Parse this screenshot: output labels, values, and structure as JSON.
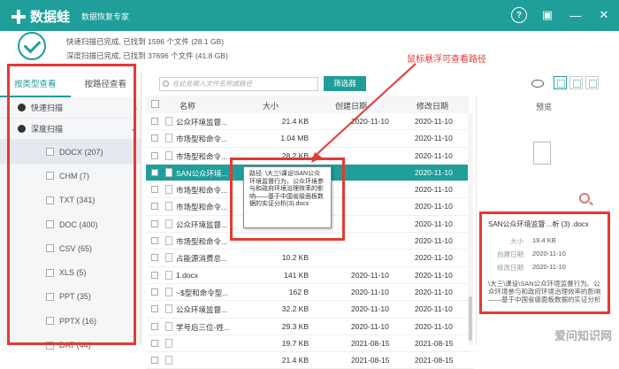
{
  "app": {
    "title": "数据蛙",
    "subtitle": "数据恢复专家"
  },
  "status": {
    "quick": "快速扫描已完成, 已找到 1596 个文件 (28.1 GB)",
    "deep": "深度扫描已完成, 已找到 37696 个文件 (41.8 GB)"
  },
  "annotation": "鼠标悬浮可查看路径",
  "left_tabs": [
    "按类型查看",
    "按路径查看"
  ],
  "tree": {
    "quick": "快速扫描",
    "deep": "深度扫描"
  },
  "types": [
    "DOCX (207)",
    "CHM (7)",
    "TXT (341)",
    "DOC (400)",
    "CSV (65)",
    "XLS (5)",
    "PPT (35)",
    "PPTX (16)",
    "DAT (44)"
  ],
  "toolbar": {
    "search_placeholder": "在此处输入文件名称或路径",
    "filter": "筛选器"
  },
  "columns": {
    "name": "名称",
    "size": "大小",
    "created": "创建日期",
    "modified": "修改日期"
  },
  "rows": [
    {
      "name": "公众环境监督...",
      "size": "21.4 KB",
      "created": "2020-11-10",
      "modified": "2020-11-10"
    },
    {
      "name": "市场型和命令...",
      "size": "1.04 MB",
      "created": "",
      "modified": "2020-11-10"
    },
    {
      "name": "市场型和命令...",
      "size": "28.2 KB",
      "created": "",
      "modified": "2020-11-10"
    },
    {
      "name": "SAN公众环境...",
      "size": "19.4 KB",
      "created": "",
      "modified": "2020-11-10"
    },
    {
      "name": "市场型和命令...",
      "size": "",
      "created": "",
      "modified": "2020-11-10"
    },
    {
      "name": "市场型和命令...",
      "size": "",
      "created": "",
      "modified": "2020-11-10"
    },
    {
      "name": "公众环境监督...",
      "size": "",
      "created": "",
      "modified": "2020-11-10"
    },
    {
      "name": "市场型和命令...",
      "size": "",
      "created": "",
      "modified": "2020-11-10"
    },
    {
      "name": "占能源消费总...",
      "size": "10.2 KB",
      "created": "",
      "modified": "2020-11-10"
    },
    {
      "name": "1.docx",
      "size": "141 KB",
      "created": "2020-11-10",
      "modified": "2020-11-10"
    },
    {
      "name": "~$型和命令型...",
      "size": "162 B",
      "created": "2020-11-10",
      "modified": "2020-11-10"
    },
    {
      "name": "公众环境监督...",
      "size": "32.2 KB",
      "created": "2020-11-10",
      "modified": "2020-11-10"
    },
    {
      "name": "学号后三位-姓...",
      "size": "29.3 KB",
      "created": "2020-11-10",
      "modified": "2020-11-10"
    },
    {
      "name": "",
      "size": "19.7 KB",
      "created": "2021-08-15",
      "modified": "2021-08-15"
    },
    {
      "name": "",
      "size": "21.4 KB",
      "created": "2021-08-15",
      "modified": "2021-08-15"
    }
  ],
  "tooltip": "路径: \\大三\\课设\\SAN公众环境监督行为、公众环境参与和政府环境治理效率的影响——基于中国省级面板数据的实证分析(3).docx",
  "preview": {
    "title": "预览",
    "filename": "SAN公众环境监督…析 (3) .docx",
    "size_label": "大小",
    "size": "19.4 KB",
    "created_label": "创建日期",
    "created": "2020-11-10",
    "modified_label": "修改日期",
    "modified": "2020-11-10",
    "path": "\\大三\\课设\\SAN公众环境监督行为、公众环境参与和政府环境治理效率的影响——基于中国省级面板数据的实证分析"
  },
  "watermark": "爱问知识网"
}
